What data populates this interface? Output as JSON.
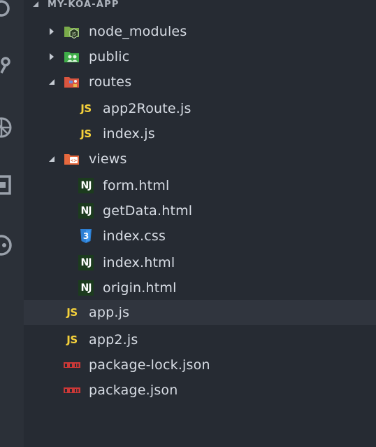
{
  "explorer": {
    "section_title": "MY-KOA-APP",
    "items": [
      {
        "name": "node_modules",
        "type": "folder-node",
        "expanded": false
      },
      {
        "name": "public",
        "type": "folder-public",
        "expanded": false
      },
      {
        "name": "routes",
        "type": "folder-routes",
        "expanded": true
      },
      {
        "name": "app2Route.js",
        "type": "js"
      },
      {
        "name": "index.js",
        "type": "js"
      },
      {
        "name": "views",
        "type": "folder-views",
        "expanded": true
      },
      {
        "name": "form.html",
        "type": "nunjucks"
      },
      {
        "name": "getData.html",
        "type": "nunjucks"
      },
      {
        "name": "index.css",
        "type": "css"
      },
      {
        "name": "index.html",
        "type": "nunjucks"
      },
      {
        "name": "origin.html",
        "type": "nunjucks"
      },
      {
        "name": "app.js",
        "type": "js",
        "selected": true
      },
      {
        "name": "app2.js",
        "type": "js"
      },
      {
        "name": "package-lock.json",
        "type": "npm"
      },
      {
        "name": "package.json",
        "type": "npm"
      }
    ]
  },
  "icons": {
    "js_glyph": "JS",
    "nj_glyph": "NJ",
    "css_glyph": "3"
  },
  "colors": {
    "background": "#262b33",
    "activity_bar": "#2b3038",
    "selected_row": "#30353e",
    "js_yellow": "#f5d13b",
    "nj_green": "#1c3b1e",
    "css_blue": "#2d7fd3",
    "npm_red": "#cb3837"
  }
}
